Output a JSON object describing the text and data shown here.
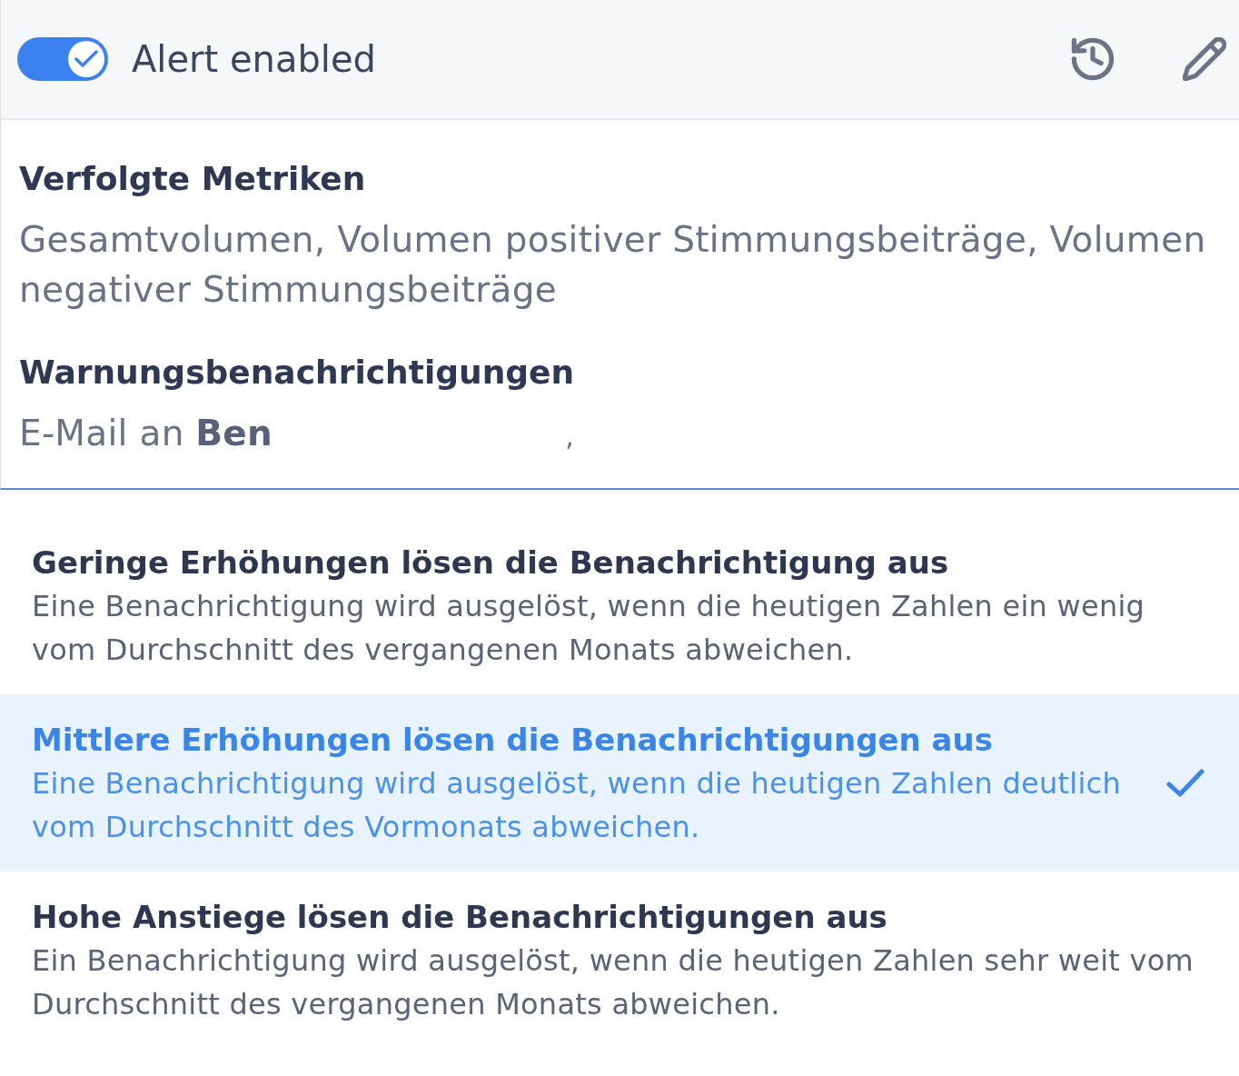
{
  "header": {
    "toggle": {
      "on": true
    },
    "label": "Alert enabled"
  },
  "tracked_metrics": {
    "heading": "Verfolgte Metriken",
    "text": "Gesamtvolumen, Volumen positiver Stimmungsbeiträge, Volumen negativer Stimmungsbeiträge"
  },
  "alert_notifications": {
    "heading": "Warnungsbenachrichtigungen",
    "text": "E-Mail an **Ben**",
    "suffix": ","
  },
  "options": [
    {
      "title": "Geringe Erhöhungen lösen die Benachrichtigung aus",
      "description": "Eine Benachrichtigung wird ausgelöst, wenn die heutigen Zahlen ein wenig vom Durchschnitt des vergangenen Monats abweichen.",
      "selected": false
    },
    {
      "title": "Mittlere Erhöhungen lösen die Benachrichtigungen aus",
      "description": "Eine Benachrichtigung wird ausgelöst, wenn die heutigen Zahlen deutlich vom Durchschnitt des Vormonats abweichen.",
      "selected": true
    },
    {
      "title": "Hohe Anstiege lösen die Benachrichtigungen aus",
      "description": "Ein Benachrichtigung wird ausgelöst, wenn die heutigen Zahlen sehr weit vom Durchschnitt des vergangenen Monats abweichen.",
      "selected": false
    }
  ]
}
